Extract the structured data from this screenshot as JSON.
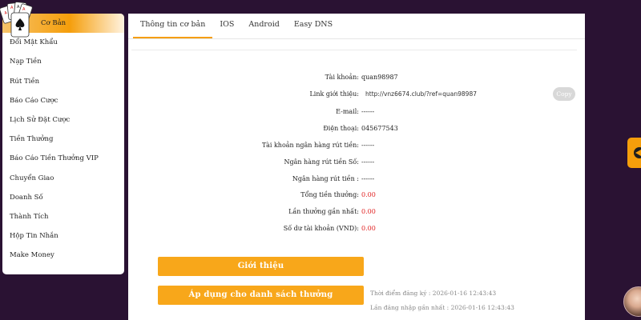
{
  "sidebar": {
    "items": [
      {
        "label": "Cơ Bản",
        "active": true
      },
      {
        "label": "Đổi Mật Khẩu"
      },
      {
        "label": "Nạp Tiền"
      },
      {
        "label": "Rút Tiền"
      },
      {
        "label": "Báo Cáo Cược"
      },
      {
        "label": "Lịch Sử Đặt Cược"
      },
      {
        "label": "Tiền Thưởng"
      },
      {
        "label": "Báo Cáo Tiền Thưởng VIP"
      },
      {
        "label": "Chuyển Giao"
      },
      {
        "label": "Doanh Số"
      },
      {
        "label": "Thành Tích"
      },
      {
        "label": "Hộp Tin Nhắn"
      },
      {
        "label": "Make Money"
      }
    ]
  },
  "tabs": [
    {
      "label": "Thông tin cơ bản",
      "active": true
    },
    {
      "label": "IOS"
    },
    {
      "label": "Android"
    },
    {
      "label": "Easy DNS"
    }
  ],
  "info": {
    "account_label": "Tài khoản:",
    "account_value": "quan98987",
    "ref_label": "Link giới thiệu:",
    "ref_value": "http://vnz6674.club/?ref=quan98987",
    "copy_label": "Copy",
    "email_label": "E-mail:",
    "email_value": "------",
    "phone_label": "Điện thoại:",
    "phone_value": "045677543",
    "bank_account_label": "Tài khoản ngân hàng rút tiền:",
    "bank_account_value": "------",
    "bank_number_label": "Ngân hàng rút tiền Số:",
    "bank_number_value": "------",
    "bank_label": "Ngân hàng rút tiền :",
    "bank_value": "------",
    "total_bonus_label": "Tổng tiền thưởng:",
    "total_bonus_value": "0.00",
    "last_bonus_label": "Lần thưởng gần nhất:",
    "last_bonus_value": "0.00",
    "balance_label": "Số dư tài khoản (VND):",
    "balance_value": "0.00"
  },
  "buttons": {
    "intro": "Giới thiệu",
    "apply": "Áp dụng cho danh sách thưởng"
  },
  "meta": {
    "register_time": "Thời điểm đăng ký : 2026-01-16 12:43:43",
    "last_login": "Lần đăng nhập gần nhất : 2026-01-16 12:43:43"
  },
  "colors": {
    "accent": "#f59e0b",
    "button": "#f8a71a",
    "background": "#2a1233",
    "red_value": "#e01e1e"
  },
  "icons": {
    "logo": "playing-cards-icon",
    "side_tab": "arrow-left-icon",
    "avatar": "avatar"
  }
}
